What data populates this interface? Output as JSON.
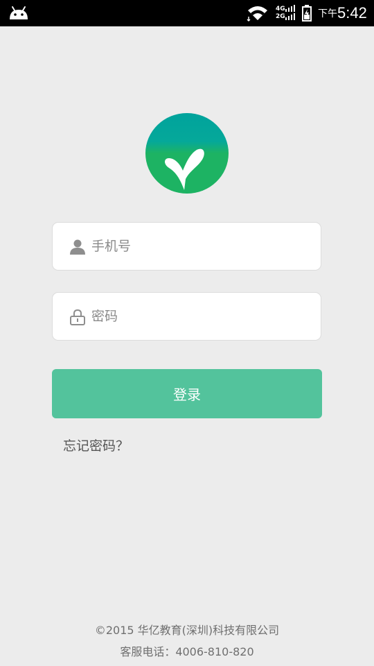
{
  "status_bar": {
    "network_top": "4G",
    "network_bottom": "2G",
    "clock_prefix": "下午",
    "clock_time": "5:42",
    "icons": [
      "android-icon",
      "wifi-icon",
      "signal-icon",
      "battery-icon"
    ]
  },
  "login": {
    "phone_placeholder": "手机号",
    "phone_value": "",
    "password_placeholder": "密码",
    "password_value": "",
    "submit_label": "登录",
    "forgot_label": "忘记密码？"
  },
  "footer": {
    "copyright": "©2015 华亿教育(深圳)科技有限公司",
    "hotline": "客服电话：4006-810-820"
  },
  "colors": {
    "accent": "#53c39c",
    "logo_top": "#00a39c",
    "logo_bottom": "#1db363",
    "background": "#ececec",
    "status_bar": "#000000"
  }
}
